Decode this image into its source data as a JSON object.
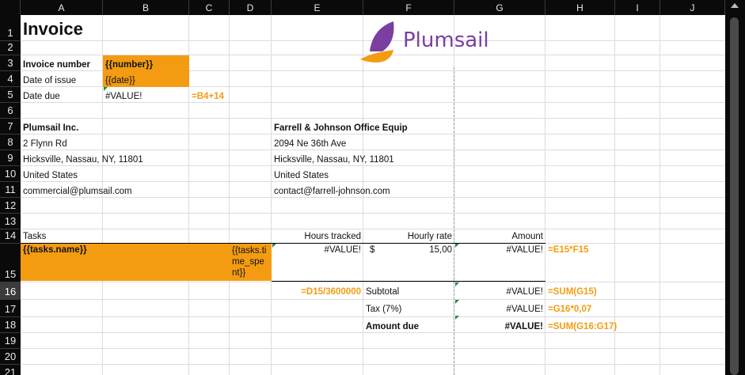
{
  "columns": [
    "A",
    "B",
    "C",
    "D",
    "E",
    "F",
    "G",
    "H",
    "I",
    "J"
  ],
  "rows": [
    "1",
    "2",
    "3",
    "4",
    "5",
    "6",
    "7",
    "8",
    "9",
    "10",
    "11",
    "12",
    "13",
    "14",
    "15",
    "16",
    "17",
    "18",
    "19",
    "20",
    "21"
  ],
  "selected_row": "16",
  "logo": {
    "text": "Plumsail",
    "color": "#7a3fa0",
    "accent": "#f39c12"
  },
  "invoice": {
    "title": "Invoice",
    "number_label": "Invoice number",
    "number_value": "{{number}}",
    "date_issue_label": "Date of issue",
    "date_issue_value": "{{date}}",
    "date_due_label": "Date due",
    "date_due_value": "#VALUE!",
    "date_due_formula": "=B4+14"
  },
  "seller": {
    "name": "Plumsail Inc.",
    "address1": "2 Flynn Rd",
    "address2": "Hicksville, Nassau, NY, 11801",
    "country": "United States",
    "email": "commercial@plumsail.com"
  },
  "buyer": {
    "name": "Farrell & Johnson Office Equip",
    "address1": "2094 Ne 36th Ave",
    "address2": "Hicksville, Nassau, NY, 11801",
    "country": "United States",
    "email": "contact@farrell-johnson.com"
  },
  "table": {
    "headers": {
      "tasks": "Tasks",
      "hours": "Hours tracked",
      "rate": "Hourly rate",
      "amount": "Amount"
    },
    "row": {
      "name": "{{tasks.name}}",
      "time_spent": "{{tasks.time_spent}}",
      "hours": "#VALUE!",
      "currency": "$",
      "rate": "15,00",
      "amount": "#VALUE!",
      "amount_formula": "=E15*F15"
    },
    "hours_formula": "=D15/3600000",
    "subtotal_label": "Subtotal",
    "subtotal_value": "#VALUE!",
    "subtotal_formula": "=SUM(G15)",
    "tax_label": "Tax (7%)",
    "tax_value": "#VALUE!",
    "tax_formula": "=G16*0,07",
    "due_label": "Amount due",
    "due_value": "#VALUE!",
    "due_formula": "=SUM(G16:G17)"
  }
}
